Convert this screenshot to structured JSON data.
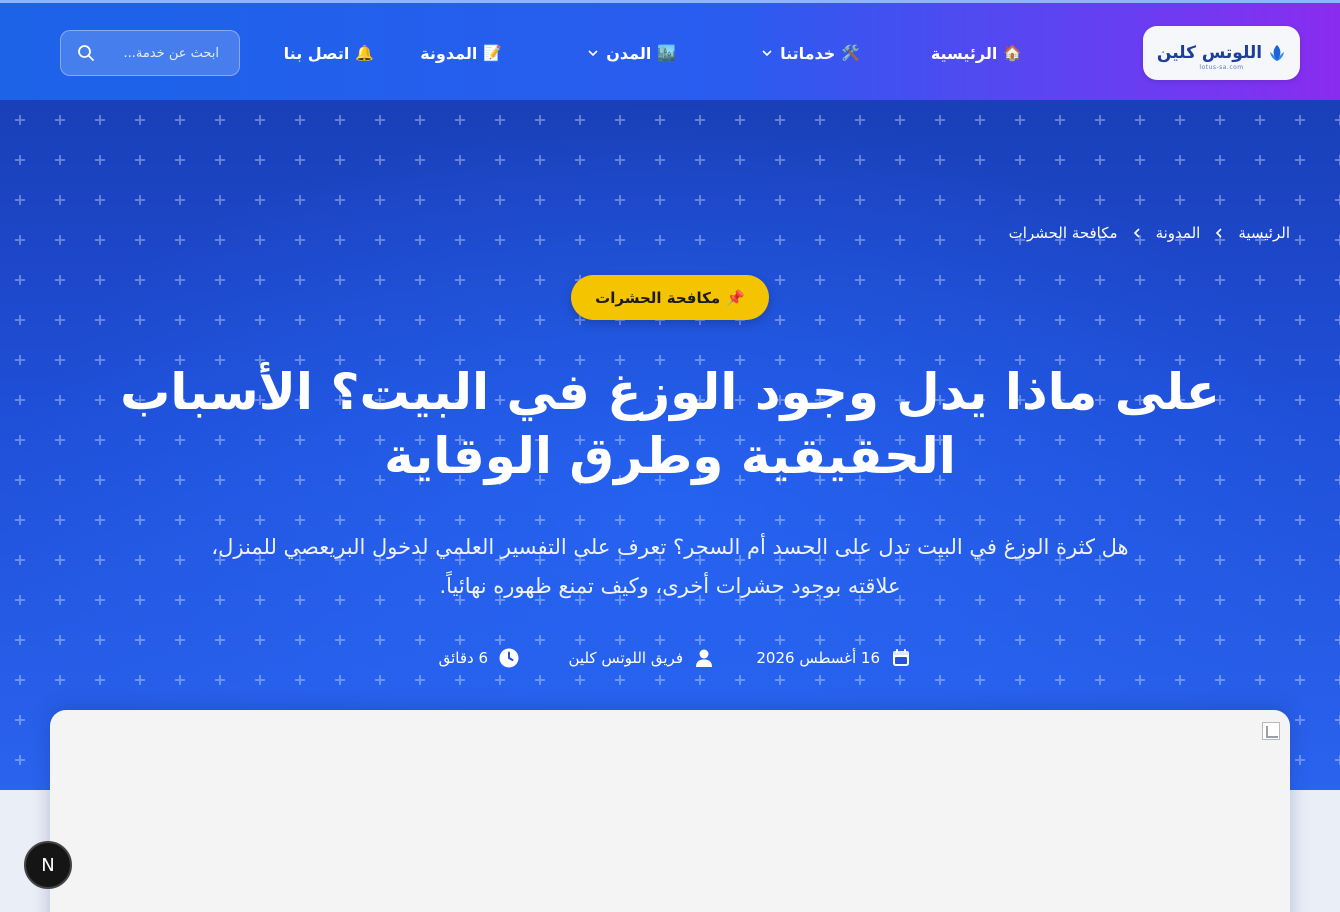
{
  "header": {
    "logo_text": "اللوتس كلين",
    "logo_sub": "lotus-sa.com",
    "nav": [
      {
        "label": "الرئيسية",
        "emoji": "🏠",
        "has_dropdown": false
      },
      {
        "label": "خدماتنا",
        "emoji": "🛠️",
        "has_dropdown": true
      },
      {
        "label": "المدن",
        "emoji": "🏙️",
        "has_dropdown": true
      },
      {
        "label": "المدونة",
        "emoji": "📝",
        "has_dropdown": false
      },
      {
        "label": "اتصل بنا",
        "emoji": "🔔",
        "has_dropdown": false
      }
    ],
    "search_placeholder": "ابحث عن خدمة..."
  },
  "breadcrumb": [
    "الرئيسية",
    "المدونة",
    "مكافحة الحشرات"
  ],
  "category_tag": {
    "emoji": "📌",
    "label": "مكافحة الحشرات"
  },
  "article": {
    "title": "على ماذا يدل وجود الوزغ في البيت؟ الأسباب الحقيقية وطرق الوقاية",
    "subtitle": "هل كثرة الوزغ في البيت تدل على الحسد أم السحر؟ تعرف على التفسير العلمي لدخول البريعصي للمنزل، علاقته بوجود حشرات أخرى، وكيف تمنع ظهوره نهائياً.",
    "date": "16 أغسطس 2026",
    "author": "فريق اللوتس كلين",
    "read_time": "6 دقائق"
  },
  "dev_badge": "N",
  "colors": {
    "header_start": "#1c63e8",
    "header_end": "#8a2cf0",
    "hero": "#1f4fd8",
    "tag": "#f5c400"
  }
}
